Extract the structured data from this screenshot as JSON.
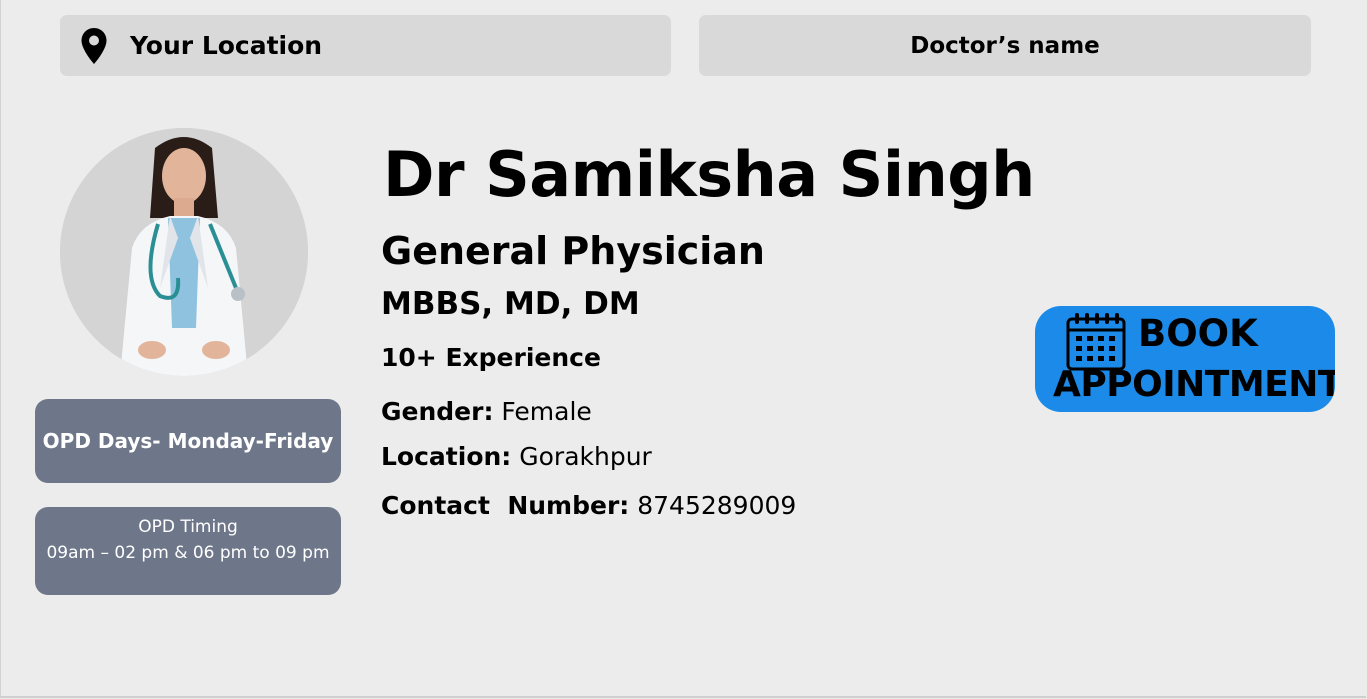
{
  "search": {
    "location_label": "Your Location",
    "doctor_label": "Doctor’s name"
  },
  "doctor": {
    "name": "Dr Samiksha Singh",
    "speciality": "General Physician",
    "degrees": "MBBS, MD, DM",
    "experience": "10+ Experience",
    "gender_label": "Gender:",
    "gender_value": "Female",
    "location_label": "Location:",
    "location_value": "Gorakhpur",
    "contact_label": "Contact  Number:",
    "contact_value": "8745289009"
  },
  "opd": {
    "days": "OPD Days- Monday-Friday",
    "timing_title": "OPD Timing",
    "timing_value": "09am – 02 pm & 06 pm to 09 pm"
  },
  "book_button": {
    "line1": "BOOK",
    "line2": "APPOINTMENT"
  },
  "icons": [
    "location-pin-icon",
    "calendar-icon"
  ],
  "colors": {
    "background": "#ececec",
    "search_bar": "#d9d9d9",
    "opd_pill": "#6e7789",
    "book_button": "#1b8ae8"
  }
}
